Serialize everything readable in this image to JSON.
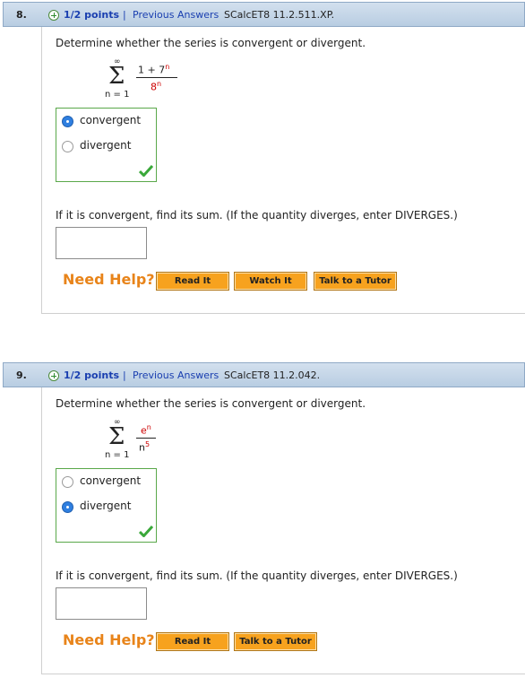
{
  "questions": [
    {
      "number": "8.",
      "points": "1/2 points",
      "separator": "|",
      "previous_answers": "Previous Answers",
      "code": "SCalcET8 11.2.511.XP.",
      "prompt": "Determine whether the series is convergent or divergent.",
      "series": {
        "upper": "∞",
        "sigma": "Σ",
        "lower": "n = 1",
        "numerator": "1 + 7",
        "numerator_exp": "n",
        "denominator": "8",
        "denominator_exp": "n"
      },
      "choices": [
        {
          "label": "convergent",
          "selected": true
        },
        {
          "label": "divergent",
          "selected": false
        }
      ],
      "sum_prompt": "If it is convergent, find its sum. (If the quantity diverges, enter DIVERGES.)",
      "answer_value": "",
      "need_help": "Need Help?",
      "help_buttons": [
        "Read It",
        "Watch It",
        "Talk to a Tutor"
      ]
    },
    {
      "number": "9.",
      "points": "1/2 points",
      "separator": "|",
      "previous_answers": "Previous Answers",
      "code": "SCalcET8 11.2.042.",
      "prompt": "Determine whether the series is convergent or divergent.",
      "series": {
        "upper": "∞",
        "sigma": "Σ",
        "lower": "n = 1",
        "numerator": "e",
        "numerator_exp": "n",
        "denominator": "n",
        "denominator_exp": "5"
      },
      "choices": [
        {
          "label": "convergent",
          "selected": false
        },
        {
          "label": "divergent",
          "selected": true
        }
      ],
      "sum_prompt": "If it is convergent, find its sum. (If the quantity diverges, enter DIVERGES.)",
      "answer_value": "",
      "need_help": "Need Help?",
      "help_buttons": [
        "Read It",
        "Talk to a Tutor"
      ]
    }
  ],
  "colors": {
    "header_bg": "#c6d6e8",
    "link_blue": "#1a3fb0",
    "correct_green": "#5aa84a",
    "need_help_orange": "#e8841a",
    "button_orange": "#f7a21e",
    "fraction_red": "#cc0000"
  }
}
